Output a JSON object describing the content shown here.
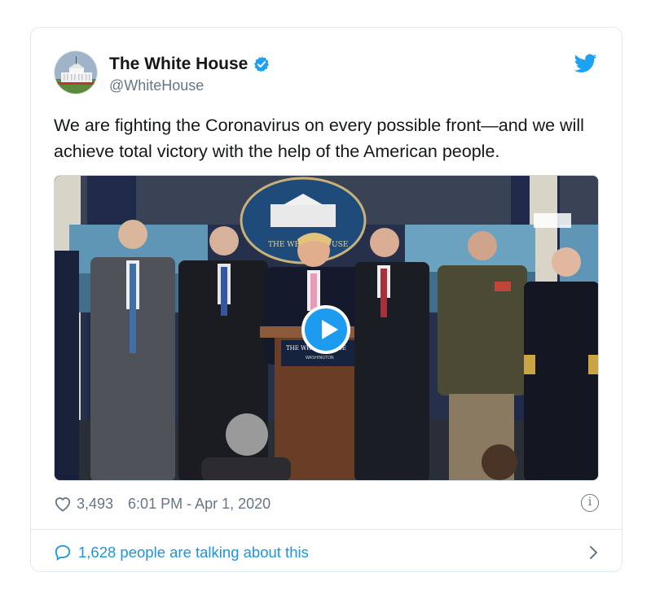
{
  "tweet": {
    "display_name": "The White House",
    "handle": "@WhiteHouse",
    "text": "We are fighting the Coronavirus on every possible front—and we will achieve total victory with the help of the American people.",
    "likes": "3,493",
    "timestamp": "6:01 PM - Apr 1, 2020",
    "conversation_label": "1,628 people are talking about this"
  },
  "media": {
    "seal_text_left": "THE WE",
    "seal_text_right": "USE",
    "podium_text": "THE WHITE HOUSE",
    "podium_subtext": "WASHINGTON"
  },
  "colors": {
    "twitter_blue": "#1da1f2",
    "link_blue": "#1b95e0",
    "muted_gray": "#657786",
    "border": "#e1e8ed"
  },
  "icons": [
    "white-house-avatar",
    "verified-badge-icon",
    "twitter-bird-icon",
    "play-icon",
    "heart-icon",
    "info-icon",
    "speech-bubble-icon",
    "chevron-right-icon"
  ]
}
